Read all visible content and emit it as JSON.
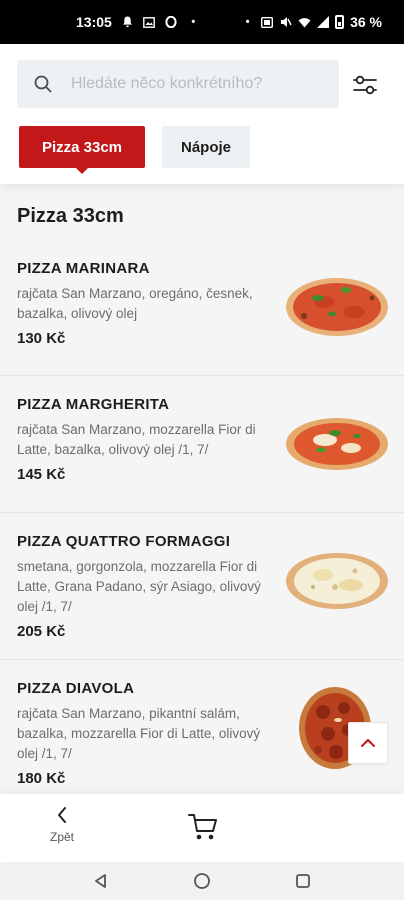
{
  "status_bar": {
    "time": "13:05",
    "battery": "36 %"
  },
  "search": {
    "placeholder": "Hledáte něco konkrétního?",
    "value": ""
  },
  "tabs": [
    {
      "label": "Pizza 33cm",
      "active": true
    },
    {
      "label": "Nápoje",
      "active": false
    }
  ],
  "section": {
    "title": "Pizza 33cm"
  },
  "items": [
    {
      "name": "PIZZA MARINARA",
      "description": "rajčata San Marzano, oregáno, česnek, bazalka, olivový olej",
      "price": "130 Kč"
    },
    {
      "name": "PIZZA MARGHERITA",
      "description": "rajčata San Marzano, mozzarella Fior di Latte, bazalka, olivový olej /1, 7/",
      "price": "145 Kč"
    },
    {
      "name": "PIZZA QUATTRO FORMAGGI",
      "description": "smetana, gorgonzola, mozzarella Fior di Latte, Grana Padano, sýr Asiago, olivový olej /1, 7/",
      "price": "205 Kč"
    },
    {
      "name": "PIZZA DIAVOLA",
      "description": "rajčata San Marzano, pikantní salám, bazalka, mozzarella Fior di Latte, olivový olej /1, 7/",
      "price": "180 Kč"
    }
  ],
  "bottom_bar": {
    "back_label": "Zpět"
  },
  "icons": {
    "search": "search-icon",
    "filter": "sliders-icon",
    "scroll_top": "chevron-up-icon",
    "back": "chevron-left-icon",
    "cart": "cart-icon"
  },
  "colors": {
    "accent": "#c21819",
    "tab_inactive": "#eef1f3",
    "text": "#1d1d1d",
    "muted": "#6d6d6d"
  }
}
